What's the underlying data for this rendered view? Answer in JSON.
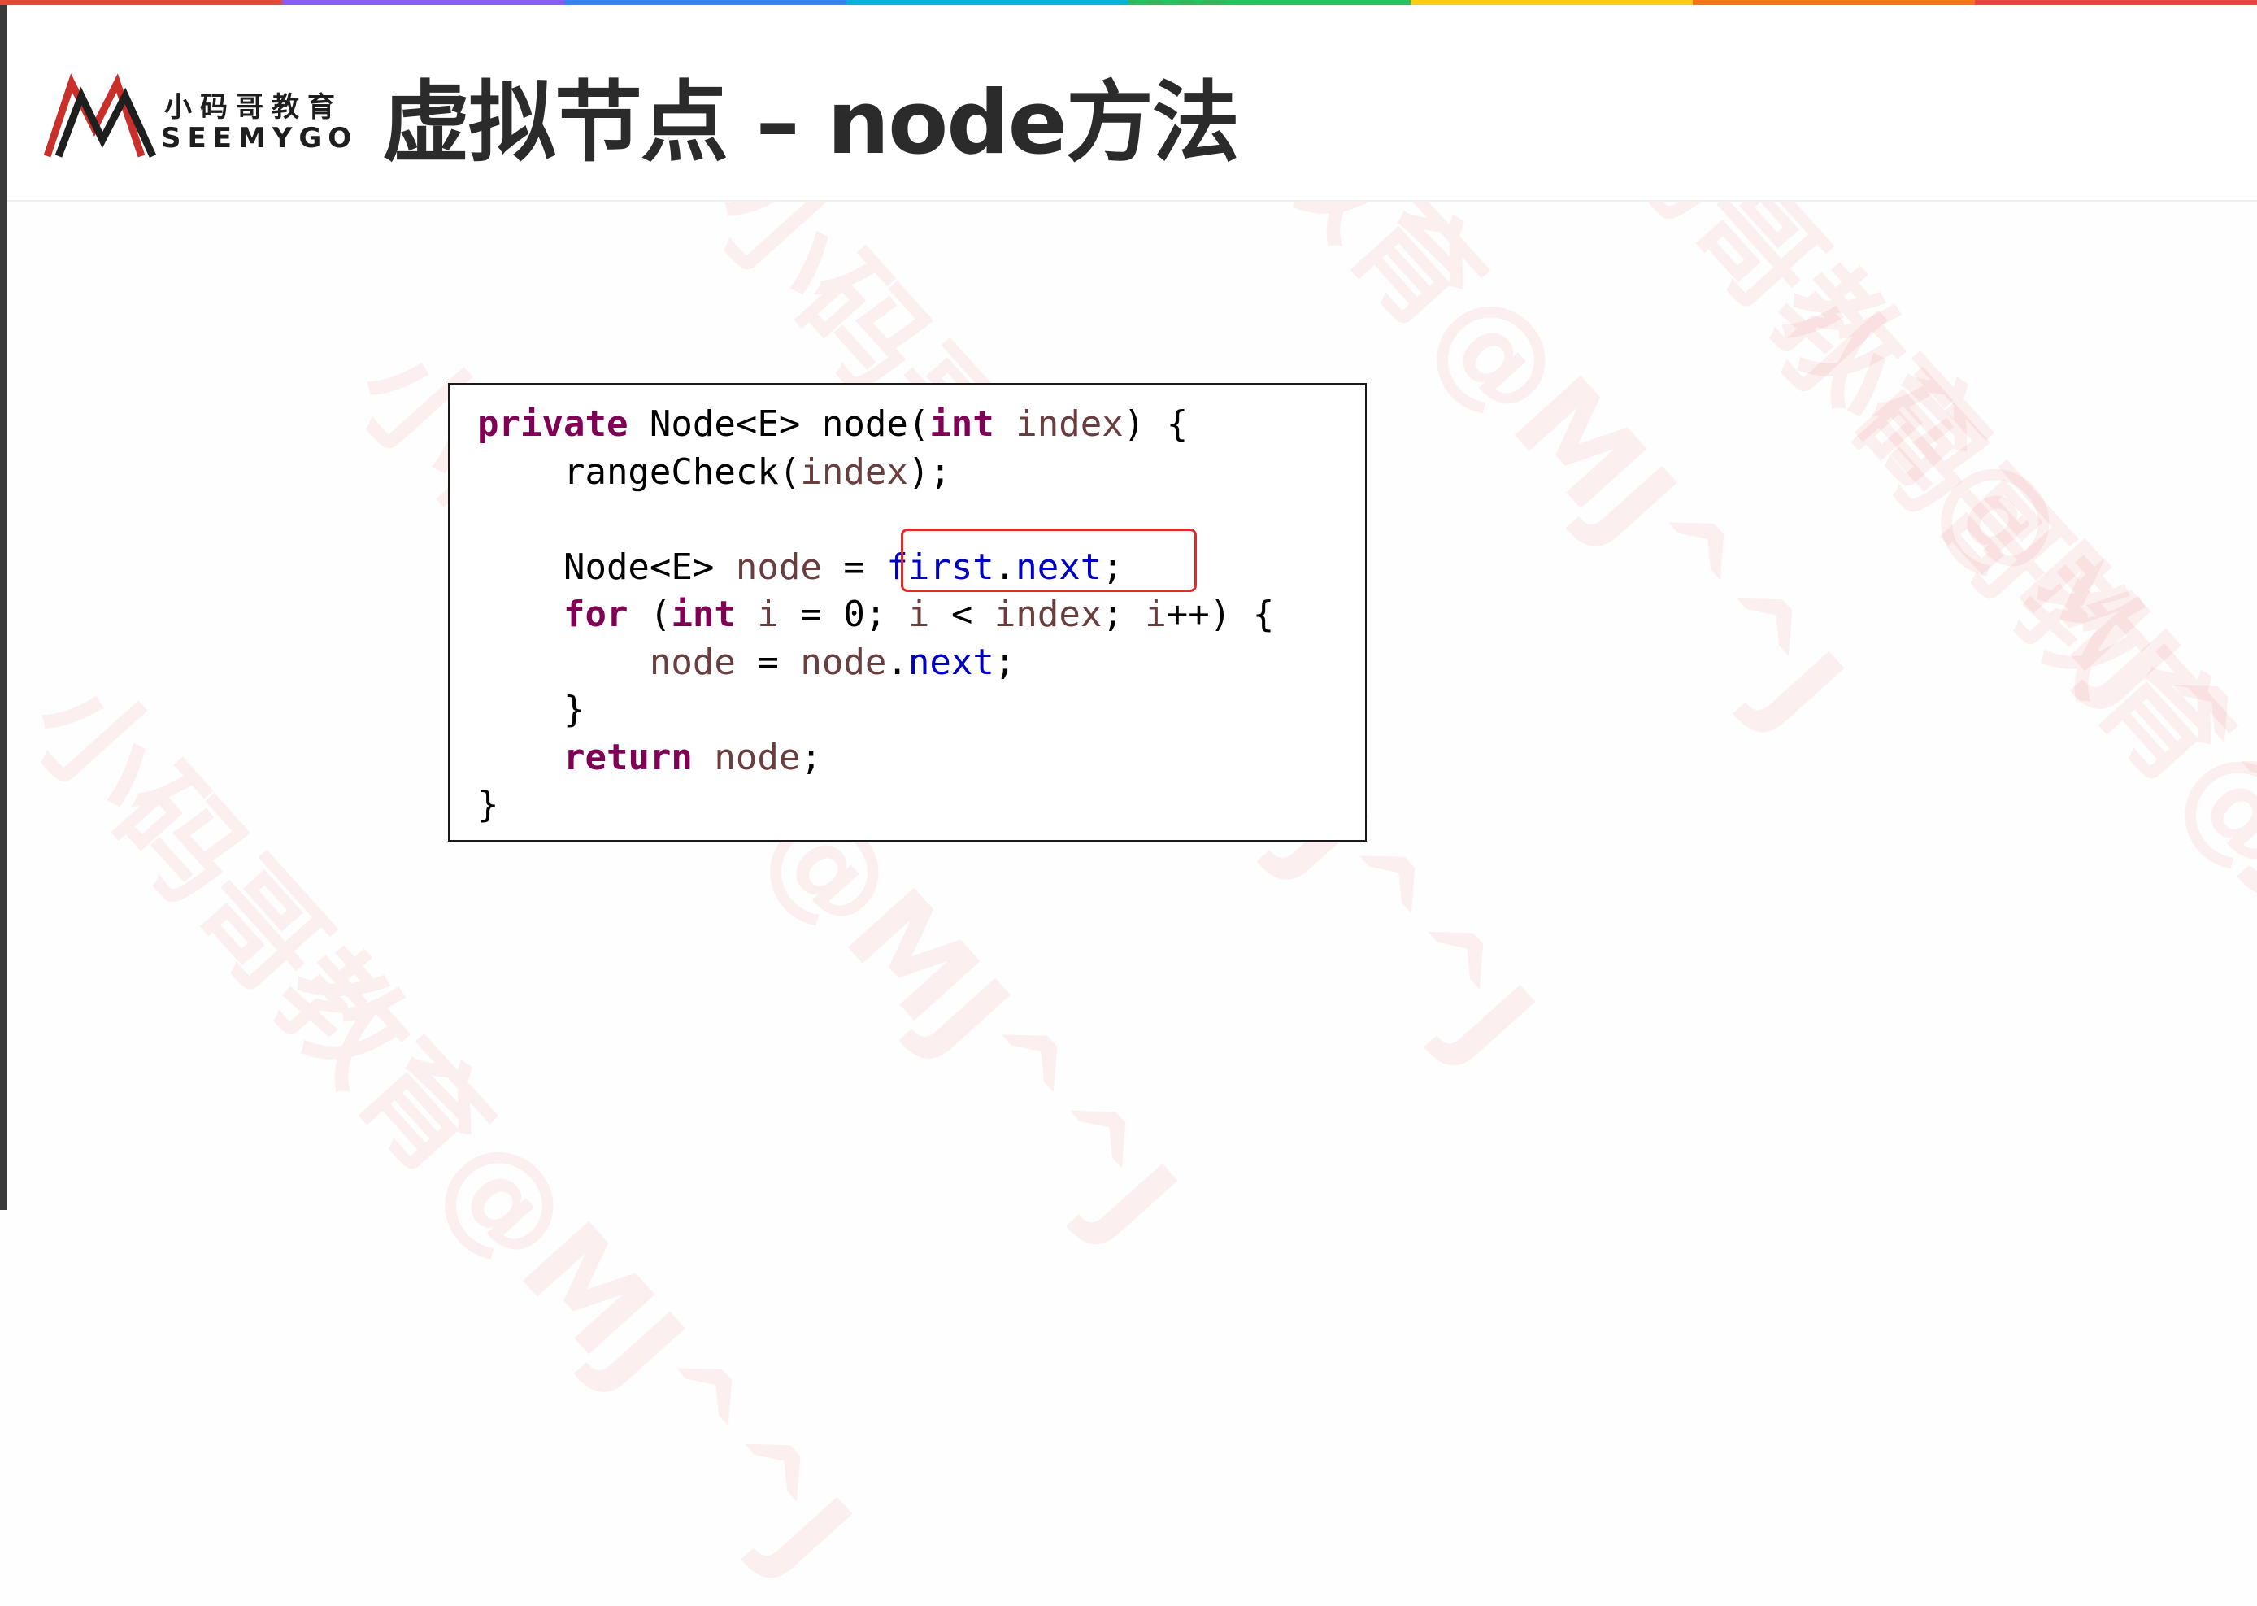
{
  "slide": {
    "title": "虚拟节点 – node方法",
    "logo": {
      "cn": "小码哥教育",
      "en": "SEEMYGO"
    },
    "watermark": "小码哥教育@MJ^^J",
    "stripe_colors": [
      "#e8483c",
      "#8b5cf6",
      "#3b82f6",
      "#06b6d4",
      "#22c55e",
      "#facc15",
      "#f97316",
      "#ef4444"
    ]
  },
  "code": {
    "language": "java",
    "highlight": "first.next;",
    "lines": [
      [
        {
          "t": "private",
          "c": "kw"
        },
        {
          "t": " Node<E> node("
        },
        {
          "t": "int",
          "c": "kw"
        },
        {
          "t": " "
        },
        {
          "t": "index",
          "c": "var"
        },
        {
          "t": ") {"
        }
      ],
      [
        {
          "t": "    rangeCheck("
        },
        {
          "t": "index",
          "c": "var"
        },
        {
          "t": ");"
        }
      ],
      [],
      [
        {
          "t": "    Node<E> "
        },
        {
          "t": "node",
          "c": "var"
        },
        {
          "t": " = "
        },
        {
          "t": "first",
          "c": "fld"
        },
        {
          "t": "."
        },
        {
          "t": "next",
          "c": "fld"
        },
        {
          "t": ";"
        }
      ],
      [
        {
          "t": "    "
        },
        {
          "t": "for",
          "c": "kw"
        },
        {
          "t": " ("
        },
        {
          "t": "int",
          "c": "kw"
        },
        {
          "t": " "
        },
        {
          "t": "i",
          "c": "var"
        },
        {
          "t": " = 0; "
        },
        {
          "t": "i",
          "c": "var"
        },
        {
          "t": " < "
        },
        {
          "t": "index",
          "c": "var"
        },
        {
          "t": "; "
        },
        {
          "t": "i",
          "c": "var"
        },
        {
          "t": "++) {"
        }
      ],
      [
        {
          "t": "        "
        },
        {
          "t": "node",
          "c": "var"
        },
        {
          "t": " = "
        },
        {
          "t": "node",
          "c": "var"
        },
        {
          "t": "."
        },
        {
          "t": "next",
          "c": "fld"
        },
        {
          "t": ";"
        }
      ],
      [
        {
          "t": "    }"
        }
      ],
      [
        {
          "t": "    "
        },
        {
          "t": "return",
          "c": "kw"
        },
        {
          "t": " "
        },
        {
          "t": "node",
          "c": "var"
        },
        {
          "t": ";"
        }
      ],
      [
        {
          "t": "}"
        }
      ]
    ]
  }
}
